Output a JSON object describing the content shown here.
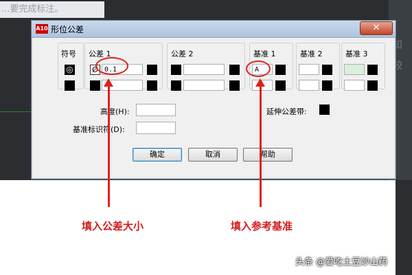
{
  "background": {
    "top_text": "...要完成标注。",
    "right_ghost_1": "知",
    "right_ghost_2": "较"
  },
  "dialog": {
    "app_icon": "A10",
    "title": "形位公差",
    "close_label": "✕",
    "groups": {
      "symbol": "符号",
      "tol1": "公差 1",
      "tol2": "公差 2",
      "datum1": "基准 1",
      "datum2": "基准 2",
      "datum3": "基准 3"
    },
    "symbol_glyph": "◎",
    "diameter_glyph": "Ø",
    "tol1_value": "0.1",
    "tol1_row2_value": "",
    "tol2_value": "",
    "datum1_value": "A",
    "datum2_value": "",
    "datum3_value": "",
    "height_label": "高度(H):",
    "height_value": "",
    "projected_zone_label": "延伸公差带:",
    "datum_identifier_label": "基准标识符(D):",
    "datum_identifier_value": "",
    "buttons": {
      "ok": "确定",
      "cancel": "取消",
      "help": "帮助"
    }
  },
  "annotations": {
    "left": "填入公差大小",
    "right": "填入参考基准",
    "color": "#e0201c"
  },
  "watermark": "头条 @爱吃土豆炒山药"
}
